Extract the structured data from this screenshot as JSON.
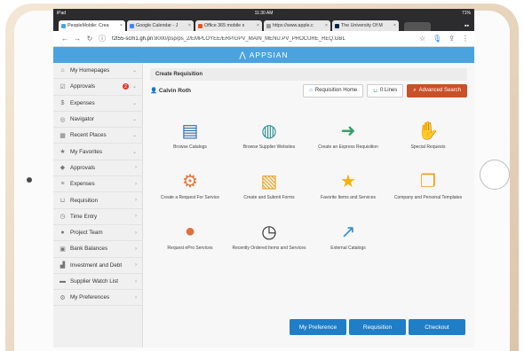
{
  "status": {
    "left": "iPad",
    "time": "11:30 AM",
    "battery": "71%"
  },
  "tabs": [
    {
      "label": "PeopleMobile: Crea",
      "color": "#4aa3df"
    },
    {
      "label": "Google Calendar - J",
      "color": "#4285f4"
    },
    {
      "label": "Office 365 mobile s",
      "color": "#f25022"
    },
    {
      "label": "https://www.apple.c",
      "color": "#999999"
    },
    {
      "label": "The University Of M",
      "color": "#00274c"
    }
  ],
  "address": {
    "host": "f2t55-scm1.gh.pri",
    "path": ":8000/psp/ps_2/EMPLOYEE/ERP/c/PV_MAIN_MENU.PV_PROCURE_REQ.GBL"
  },
  "brand": {
    "name": "APPSIAN"
  },
  "sidebar": {
    "items": [
      {
        "label": "My Homepages",
        "icon": "home-icon",
        "glyph": "⌂",
        "chev": "⌄"
      },
      {
        "label": "Approvals",
        "icon": "check-icon",
        "glyph": "☑",
        "badge": "2",
        "chev": "⌄"
      },
      {
        "label": "Expenses",
        "icon": "dollar-icon",
        "glyph": "$",
        "chev": "⌄"
      },
      {
        "label": "Navigator",
        "icon": "compass-icon",
        "glyph": "◎",
        "chev": "⌄"
      },
      {
        "label": "Recent Places",
        "icon": "calendar-icon",
        "glyph": "▦",
        "chev": "⌄"
      },
      {
        "label": "My Favorites",
        "icon": "star-icon",
        "glyph": "★",
        "chev": "⌄"
      },
      {
        "label": "Approvals",
        "icon": "approvals-icon",
        "glyph": "◆",
        "chev": "›"
      },
      {
        "label": "Expenses",
        "icon": "expenses-icon",
        "glyph": "≡",
        "chev": "›"
      },
      {
        "label": "Requisition",
        "icon": "cart-icon",
        "glyph": "⊔",
        "chev": "›"
      },
      {
        "label": "Time Entry",
        "icon": "clock-icon",
        "glyph": "◷",
        "chev": "›"
      },
      {
        "label": "Project Team",
        "icon": "team-icon",
        "glyph": "●",
        "chev": "›"
      },
      {
        "label": "Bank Balances",
        "icon": "bank-icon",
        "glyph": "▣",
        "chev": "›"
      },
      {
        "label": "Investment and Debt",
        "icon": "chart-icon",
        "glyph": "▟",
        "chev": "›"
      },
      {
        "label": "Supplier Watch List",
        "icon": "truck-icon",
        "glyph": "▬",
        "chev": "›"
      },
      {
        "label": "My Preferences",
        "icon": "prefs-icon",
        "glyph": "⚙",
        "chev": "›"
      }
    ]
  },
  "main": {
    "breadcrumb": "Create Requisition",
    "user": "Calvin Roth",
    "buttons": {
      "home": "Requisition Home",
      "lines": "0 Lines",
      "advanced": "Advanced Search"
    },
    "tiles": [
      {
        "label": "Browse Catalogs",
        "icon": "book-icon",
        "color": "#2d6fb3",
        "glyph": "▤"
      },
      {
        "label": "Browse Supplier Websites",
        "icon": "globe-icon",
        "color": "#2f8f8f",
        "glyph": "◍"
      },
      {
        "label": "Create an Express Requisition",
        "icon": "arrow-right-icon",
        "color": "#3d9c6b",
        "glyph": "➜"
      },
      {
        "label": "Special Requests",
        "icon": "handshake-icon",
        "color": "#d9673d",
        "glyph": "✋"
      },
      {
        "label": "Create a Request For Service",
        "icon": "people-gear-icon",
        "color": "#e07a3a",
        "glyph": "⚙"
      },
      {
        "label": "Create and Submit Forms",
        "icon": "form-icon",
        "color": "#f0a020",
        "glyph": "▧"
      },
      {
        "label": "Favorite Items and Services",
        "icon": "favorite-star-icon",
        "color": "#f4b400",
        "glyph": "★"
      },
      {
        "label": "Company and Personal Templates",
        "icon": "templates-icon",
        "color": "#f0a020",
        "glyph": "❐"
      },
      {
        "label": "Request ePro Services",
        "icon": "people-icon",
        "color": "#e0703a",
        "glyph": "●"
      },
      {
        "label": "Recently Ordered Items and Services",
        "icon": "recent-clock-icon",
        "color": "#333333",
        "glyph": "◷"
      },
      {
        "label": "External Catalogs",
        "icon": "external-link-icon",
        "color": "#2f8fd0",
        "glyph": "↗"
      }
    ],
    "bottom_buttons": {
      "prefs": "My Preference",
      "req": "Requisition",
      "checkout": "Checkout"
    }
  }
}
